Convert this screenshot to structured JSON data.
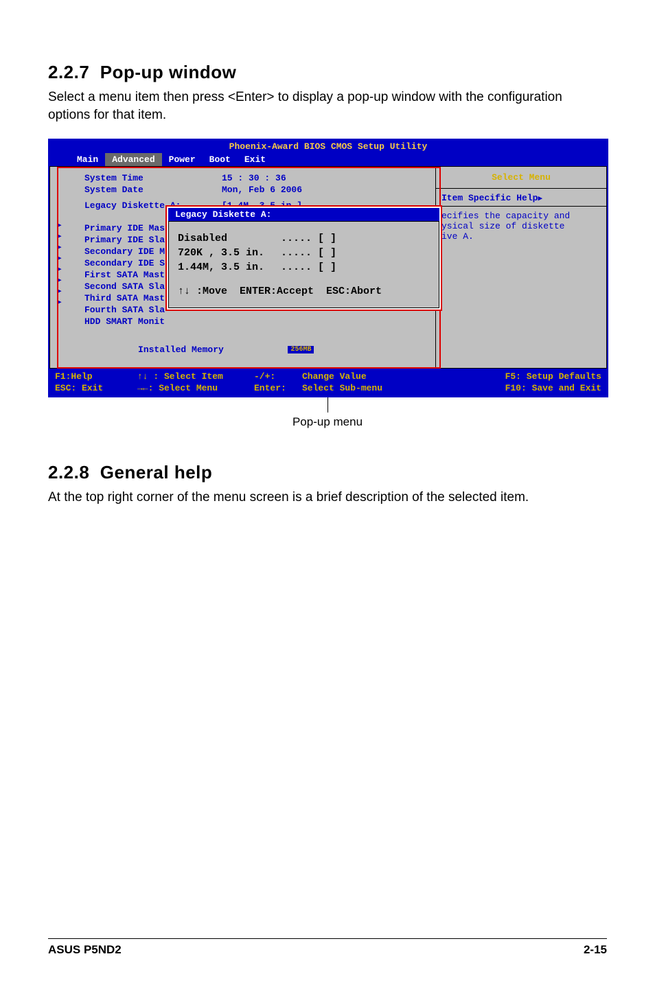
{
  "section1": {
    "number": "2.2.7",
    "title": "Pop-up window",
    "text": "Select a menu item then press <Enter> to display a pop-up window with the configuration options for that item."
  },
  "bios": {
    "title": "Phoenix-Award BIOS CMOS Setup Utility",
    "tabs": [
      "Main",
      "Advanced",
      "Power",
      "Boot",
      "Exit"
    ],
    "active_tab": "Advanced",
    "rows": {
      "time_label": "System Time",
      "time_value": "15 : 30 : 36",
      "date_label": "System Date",
      "date_value": "Mon, Feb 6 2006",
      "legacy_label": "Legacy Diskette A:",
      "legacy_value": "[1.4M, 3.5 in.]",
      "items": [
        "Primary IDE Mas",
        "Primary IDE Sla",
        "Secondary IDE M",
        "Secondary IDE S",
        "First SATA Mast",
        "Second SATA Sla",
        "Third SATA Mast",
        "Fourth SATA Sla",
        "HDD SMART Monit"
      ],
      "installed": "Installed Memory",
      "mem_cover": "256MB"
    },
    "right": {
      "select_menu": "Select Menu",
      "help_title": "Item Specific Help",
      "help_text": "ecifies the capacity and\nysical size of diskette\nive A."
    },
    "popup": {
      "title": "Legacy Diskette A:",
      "options": [
        {
          "name": "Disabled",
          "dots": "..... [ ]"
        },
        {
          "name": "720K , 3.5 in.",
          "dots": "..... [ ]"
        },
        {
          "name": "1.44M, 3.5 in.",
          "dots": "..... [ ]"
        }
      ],
      "hint": "↑↓ :Move  ENTER:Accept  ESC:Abort"
    },
    "legend": {
      "r1c1": "F1:Help",
      "r1c2": "↑↓ : Select Item",
      "r1c3": "-/+:",
      "r1c4": "Change Value",
      "r1c5": "F5: Setup Defaults",
      "r2c1": "ESC: Exit",
      "r2c2": "→←: Select Menu",
      "r2c3": "Enter:",
      "r2c4": "Select Sub-menu",
      "r2c5": "F10: Save and Exit"
    }
  },
  "caption": "Pop-up menu",
  "section2": {
    "number": "2.2.8",
    "title": "General help",
    "text": "At the top right corner of the menu screen is a brief description of the selected item."
  },
  "footer": {
    "left": "ASUS P5ND2",
    "right": "2-15"
  }
}
